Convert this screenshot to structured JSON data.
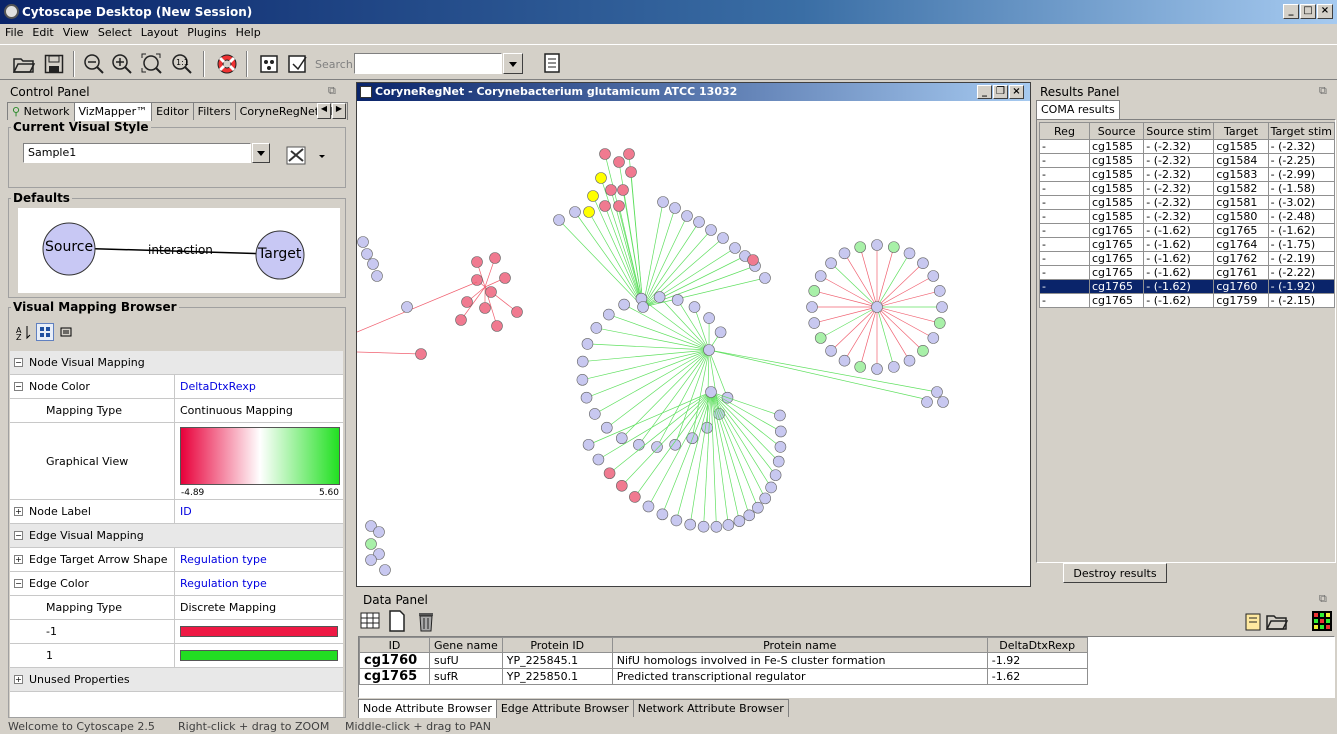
{
  "window": {
    "title": "Cytoscape Desktop (New Session)"
  },
  "menu": [
    "File",
    "Edit",
    "View",
    "Select",
    "Layout",
    "Plugins",
    "Help"
  ],
  "toolbar": {
    "icons": [
      "open-folder-icon",
      "save-icon",
      "zoom-out-icon",
      "zoom-in-icon",
      "zoom-fit-icon",
      "zoom-selected-icon",
      "lifebuoy-icon",
      "new-network-icon",
      "export-icon",
      "details-icon"
    ],
    "search_label": "Search:",
    "search_value": ""
  },
  "control_panel": {
    "title": "Control Panel",
    "tabs": [
      "Network",
      "VizMapper™",
      "Editor",
      "Filters",
      "CoryneRegNet pl..."
    ],
    "selected_tab": "VizMapper™",
    "current_visual_style": {
      "legend": "Current Visual Style",
      "value": "Sample1"
    },
    "defaults": {
      "legend": "Defaults",
      "source": "Source",
      "edge": "interaction",
      "target": "Target"
    },
    "vmb": {
      "legend": "Visual Mapping Browser",
      "rows": [
        {
          "key": "Node Visual Mapping",
          "value": "",
          "sign": "−",
          "section": true
        },
        {
          "key": "Node Color",
          "value": "DeltaDtxRexp",
          "sign": "−",
          "blue": true
        },
        {
          "key": "Mapping Type",
          "value": "Continuous Mapping",
          "indent": true
        },
        {
          "key": "Graphical View",
          "value": "",
          "indent": true,
          "gradient": true
        },
        {
          "key": "Node Label",
          "value": "ID",
          "sign": "+",
          "blue": true
        },
        {
          "key": "Edge Visual Mapping",
          "value": "",
          "sign": "−",
          "section": true
        },
        {
          "key": "Edge Target Arrow Shape",
          "value": "Regulation type",
          "sign": "+",
          "blue": true
        },
        {
          "key": "Edge Color",
          "value": "Regulation type",
          "sign": "−",
          "blue": true
        },
        {
          "key": "Mapping Type",
          "value": "Discrete Mapping",
          "indent": true
        },
        {
          "key": "-1",
          "value": "",
          "indent": true,
          "swatch": "#ee1944"
        },
        {
          "key": "1",
          "value": "",
          "indent": true,
          "swatch": "#22dd22"
        },
        {
          "key": "Unused Properties",
          "value": "",
          "sign": "+",
          "section": true
        }
      ],
      "gradient_min": "-4.89",
      "gradient_max": "5.60"
    }
  },
  "network": {
    "title": "CoryneRegNet - Corynebacterium glutamicum ATCC 13032"
  },
  "results_panel": {
    "title": "Results Panel",
    "tab": "COMA results",
    "columns": [
      "Reg",
      "Source",
      "Source stim",
      "Target",
      "Target stim"
    ],
    "rows": [
      [
        "-",
        "cg1585",
        "- (-2.32)",
        "cg1585",
        "- (-2.32)"
      ],
      [
        "-",
        "cg1585",
        "- (-2.32)",
        "cg1584",
        "- (-2.25)"
      ],
      [
        "-",
        "cg1585",
        "- (-2.32)",
        "cg1583",
        "- (-2.99)"
      ],
      [
        "-",
        "cg1585",
        "- (-2.32)",
        "cg1582",
        "- (-1.58)"
      ],
      [
        "-",
        "cg1585",
        "- (-2.32)",
        "cg1581",
        "- (-3.02)"
      ],
      [
        "-",
        "cg1585",
        "- (-2.32)",
        "cg1580",
        "- (-2.48)"
      ],
      [
        "-",
        "cg1765",
        "- (-1.62)",
        "cg1765",
        "- (-1.62)"
      ],
      [
        "-",
        "cg1765",
        "- (-1.62)",
        "cg1764",
        "- (-1.75)"
      ],
      [
        "-",
        "cg1765",
        "- (-1.62)",
        "cg1762",
        "- (-2.19)"
      ],
      [
        "-",
        "cg1765",
        "- (-1.62)",
        "cg1761",
        "- (-2.22)"
      ],
      [
        "-",
        "cg1765",
        "- (-1.62)",
        "cg1760",
        "- (-1.92)"
      ],
      [
        "-",
        "cg1765",
        "- (-1.62)",
        "cg1759",
        "- (-2.15)"
      ]
    ],
    "selected_row": 10,
    "destroy_button": "Destroy results"
  },
  "data_panel": {
    "title": "Data Panel",
    "columns": [
      "ID",
      "Gene name",
      "Protein ID",
      "Protein name",
      "DeltaDtxRexp"
    ],
    "rows": [
      [
        "cg1760",
        "sufU",
        "YP_225845.1",
        "NifU homologs involved in Fe-S cluster formation",
        "-1.92"
      ],
      [
        "cg1765",
        "sufR",
        "YP_225850.1",
        "Predicted transcriptional regulator",
        "-1.62"
      ]
    ],
    "tabs": [
      "Node Attribute Browser",
      "Edge Attribute Browser",
      "Network Attribute Browser"
    ]
  },
  "status": {
    "left": "Welcome to Cytoscape 2.5",
    "mid": "Right-click + drag  to  ZOOM",
    "right": "Middle-click + drag  to  PAN"
  },
  "colors": {
    "node_default": "#c8c8f0",
    "node_red": "#f07a90",
    "node_green": "#a8f0a8",
    "node_yellow": "#ffff00",
    "edge_green": "#60e060",
    "edge_red": "#f06070"
  }
}
